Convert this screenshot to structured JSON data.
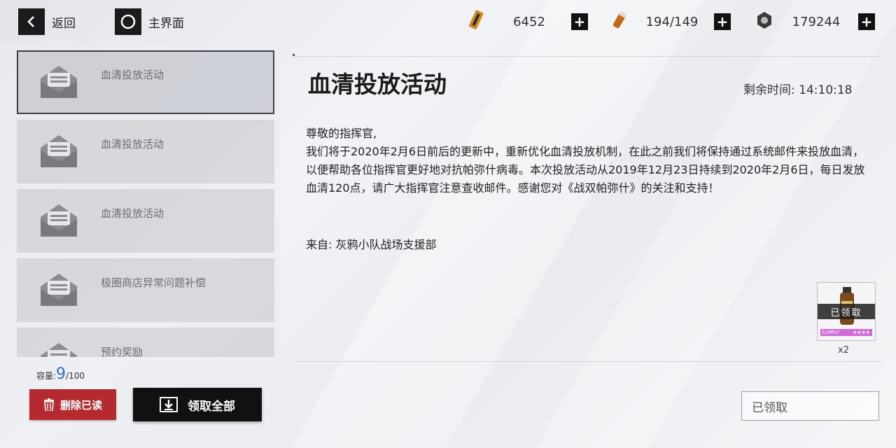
{
  "nav": {
    "back_label": "返回",
    "home_label": "主界面"
  },
  "currencies": [
    {
      "icon": "ticket-icon",
      "value": "6452"
    },
    {
      "icon": "serum-icon",
      "value": "194/149"
    },
    {
      "icon": "gear-coin-icon",
      "value": "179244"
    }
  ],
  "mail_list": [
    {
      "title": "血清投放活动"
    },
    {
      "title": "血清投放活动"
    },
    {
      "title": "血清投放活动"
    },
    {
      "title": "极圈商店异常问题补偿"
    },
    {
      "title": "预约奖励"
    }
  ],
  "capacity": {
    "label": "容量:",
    "count": "9",
    "max": "/100"
  },
  "actions": {
    "delete_read": "删除已读",
    "claim_all": "领取全部"
  },
  "mail": {
    "title": "血清投放活动",
    "remaining_label": "剩余时间:",
    "remaining_time": "14:10:18",
    "greeting": "尊敬的指挥官,",
    "body": "我们将于2020年2月6日前后的更新中，重新优化血清投放机制，在此之前我们将保持通过系统邮件来投放血清，以便帮助各位指挥官更好地对抗帕弥什病毒。本次投放活动从2019年12月23日持续到2020年2月6日，每日发放血清120点，请广大指挥官注意查收邮件。感谢您对《战双帕弥什》的关注和支持！",
    "from": "来自: 灰鸦小队战场支援部"
  },
  "reward": {
    "claimed_label": "已领取",
    "band_text": "SUPPLY",
    "stars": "★★★★",
    "count": "x2"
  },
  "claim_button": {
    "label": "已领取"
  }
}
